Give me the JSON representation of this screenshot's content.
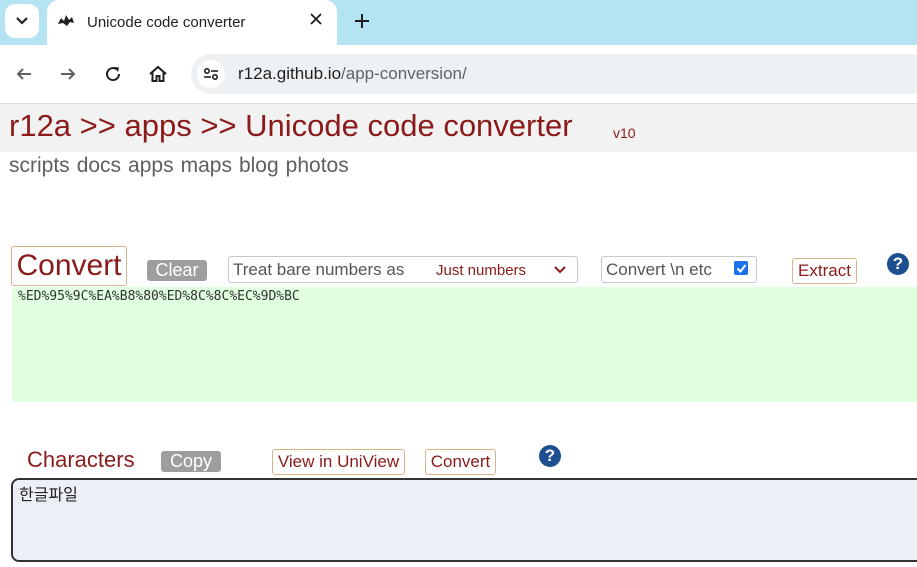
{
  "browser": {
    "tab_title": "Unicode code converter",
    "url_host": "r12a.github.io",
    "url_path": "/app-conversion/",
    "icons": [
      "chevron-down-icon",
      "favicon-icon",
      "close-icon",
      "plus-icon",
      "back-icon",
      "forward-icon",
      "reload-icon",
      "home-icon",
      "site-info-icon"
    ]
  },
  "header": {
    "title": "r12a >> apps >> Unicode code converter",
    "version": "v10"
  },
  "site_nav": [
    "scripts",
    "docs",
    "apps",
    "maps",
    "blog",
    "photos"
  ],
  "controls": {
    "convert_label": "Convert",
    "clear_label": "Clear",
    "treat_label": "Treat bare numbers as",
    "treat_value": "Just numbers",
    "escape_label": "Convert \\n etc",
    "escape_checked": true,
    "extract_label": "Extract",
    "help_label": "?"
  },
  "codes_value": "%ED%95%9C%EA%B8%80%ED%8C%8C%EC%9D%BC",
  "characters": {
    "label": "Characters",
    "copy_label": "Copy",
    "uniview_label": "View in UniView",
    "convert_label": "Convert",
    "help_label": "?",
    "value": "한글파일"
  },
  "colors": {
    "tabstrip": "#b4e3f1",
    "accent": "#8b1a1a",
    "codes_bg": "#dfffdf",
    "chars_bg": "#eceff5"
  }
}
